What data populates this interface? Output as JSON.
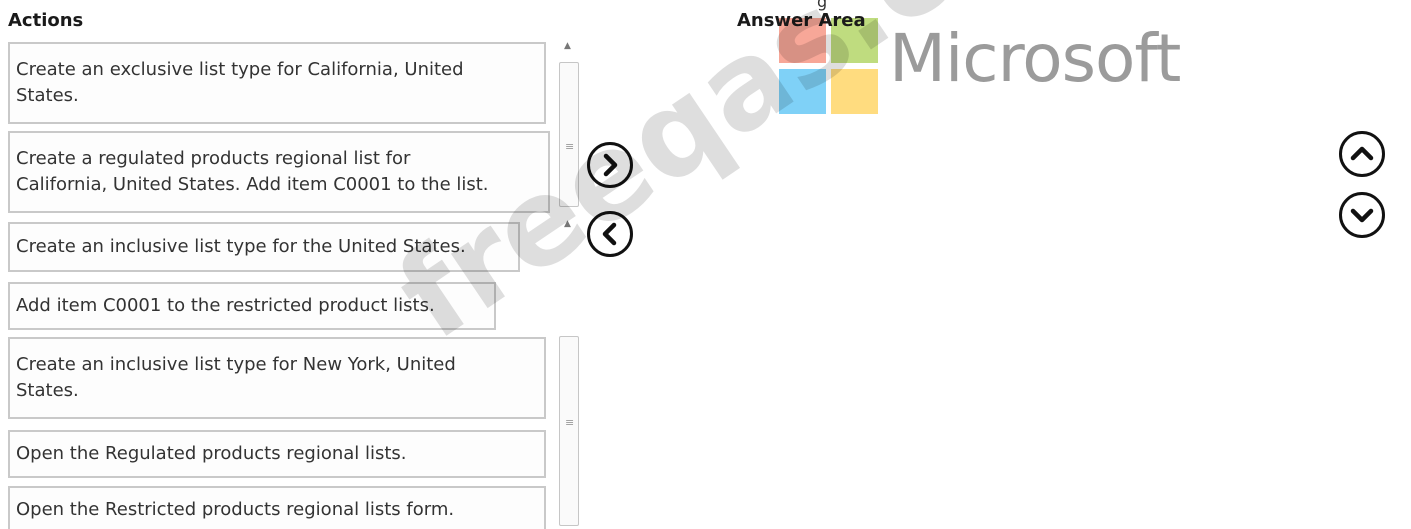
{
  "actions": {
    "title": "Actions",
    "items": [
      {
        "lines": [
          "Create an exclusive list type for California, United",
          "States."
        ]
      },
      {
        "lines": [
          "Create a regulated products regional list for",
          "California, United States. Add item C0001 to the list."
        ]
      },
      {
        "lines": [
          "Create an inclusive list type for the United States."
        ]
      },
      {
        "lines": [
          "Add item C0001 to the restricted product lists."
        ]
      },
      {
        "lines": [
          "Create an inclusive list type for New York, United",
          "States."
        ]
      },
      {
        "lines": [
          "Open the Regulated products regional lists."
        ]
      },
      {
        "lines": [
          "Open the Restricted products regional lists form."
        ]
      }
    ]
  },
  "answer_area": {
    "title": "Answer Area"
  },
  "buttons": {
    "move_right": "chevron-right",
    "move_left": "chevron-left",
    "move_up": "chevron-up",
    "move_down": "chevron-down"
  },
  "watermark": {
    "logo_text": "Microsoft",
    "text": "freeqas.com",
    "logo_colors": [
      "#f05032",
      "#7fba00",
      "#00a4ef",
      "#ffb900"
    ]
  },
  "partial_text": "g"
}
